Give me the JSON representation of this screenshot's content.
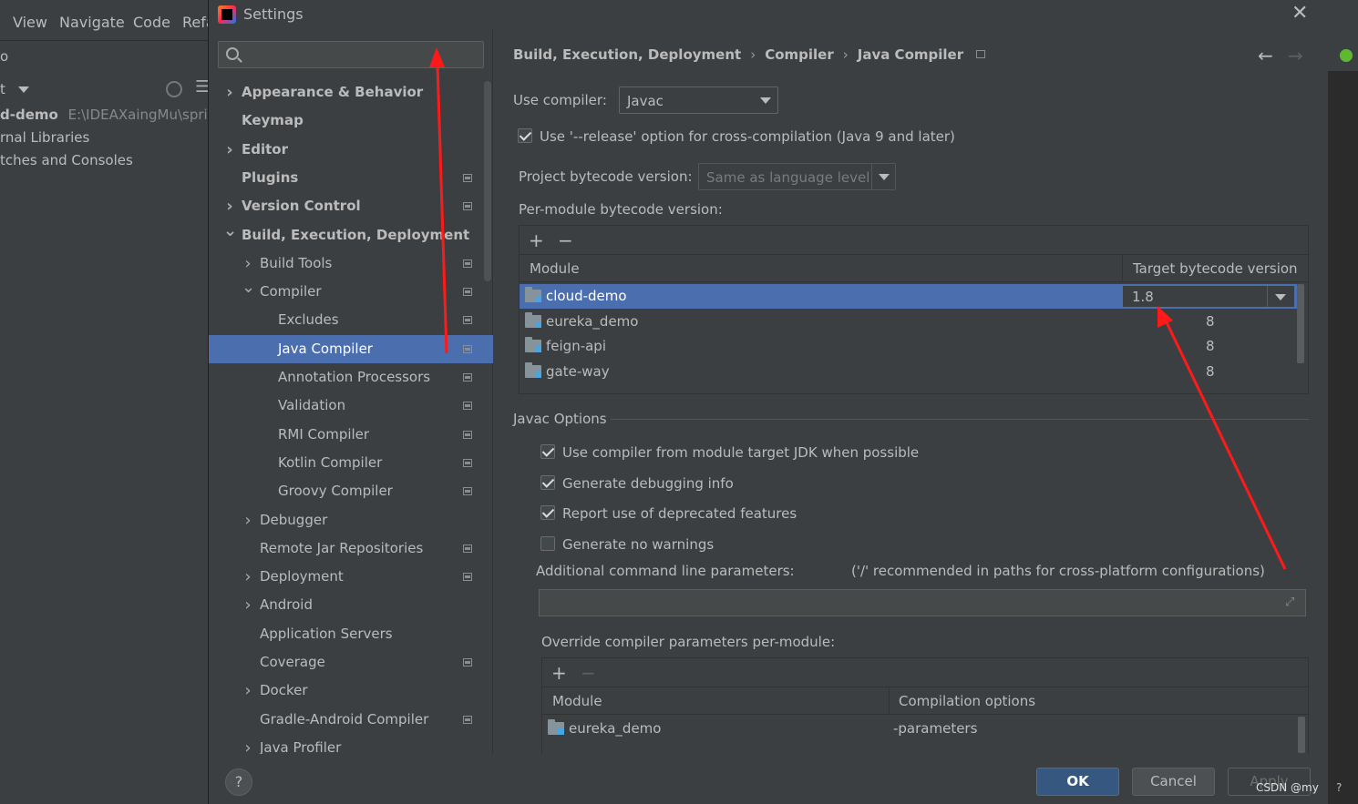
{
  "ide": {
    "menu": [
      "View",
      "Navigate",
      "Code",
      "Refa"
    ],
    "project_lines": [
      {
        "prefix": "d-demo",
        "path": "E:\\IDEAXaingMu\\sprin"
      },
      {
        "prefix": "rnal Libraries",
        "path": ""
      },
      {
        "prefix": "tches and Consoles",
        "path": ""
      }
    ],
    "toolbar_left_partial": "o",
    "toolbar_second_partial": "t"
  },
  "dialog": {
    "title": "Settings",
    "search": {
      "value": "",
      "placeholder": ""
    },
    "tree": [
      {
        "label": "Appearance & Behavior",
        "level": 0,
        "bold": true,
        "chevron": "right",
        "badge": false
      },
      {
        "label": "Keymap",
        "level": 0,
        "bold": true,
        "chevron": "",
        "badge": false
      },
      {
        "label": "Editor",
        "level": 0,
        "bold": true,
        "chevron": "right",
        "badge": false
      },
      {
        "label": "Plugins",
        "level": 0,
        "bold": true,
        "chevron": "",
        "badge": true
      },
      {
        "label": "Version Control",
        "level": 0,
        "bold": true,
        "chevron": "right",
        "badge": true
      },
      {
        "label": "Build, Execution, Deployment",
        "level": 0,
        "bold": true,
        "chevron": "down",
        "badge": false
      },
      {
        "label": "Build Tools",
        "level": 1,
        "bold": false,
        "chevron": "right",
        "badge": true
      },
      {
        "label": "Compiler",
        "level": 1,
        "bold": false,
        "chevron": "down",
        "badge": true
      },
      {
        "label": "Excludes",
        "level": 2,
        "bold": false,
        "chevron": "",
        "badge": true
      },
      {
        "label": "Java Compiler",
        "level": 2,
        "bold": false,
        "chevron": "",
        "badge": true,
        "selected": true
      },
      {
        "label": "Annotation Processors",
        "level": 2,
        "bold": false,
        "chevron": "",
        "badge": true
      },
      {
        "label": "Validation",
        "level": 2,
        "bold": false,
        "chevron": "",
        "badge": true
      },
      {
        "label": "RMI Compiler",
        "level": 2,
        "bold": false,
        "chevron": "",
        "badge": true
      },
      {
        "label": "Kotlin Compiler",
        "level": 2,
        "bold": false,
        "chevron": "",
        "badge": true
      },
      {
        "label": "Groovy Compiler",
        "level": 2,
        "bold": false,
        "chevron": "",
        "badge": true
      },
      {
        "label": "Debugger",
        "level": 1,
        "bold": false,
        "chevron": "right",
        "badge": false
      },
      {
        "label": "Remote Jar Repositories",
        "level": 1,
        "bold": false,
        "chevron": "",
        "badge": true
      },
      {
        "label": "Deployment",
        "level": 1,
        "bold": false,
        "chevron": "right",
        "badge": true
      },
      {
        "label": "Android",
        "level": 1,
        "bold": false,
        "chevron": "right",
        "badge": false
      },
      {
        "label": "Application Servers",
        "level": 1,
        "bold": false,
        "chevron": "",
        "badge": false
      },
      {
        "label": "Coverage",
        "level": 1,
        "bold": false,
        "chevron": "",
        "badge": true
      },
      {
        "label": "Docker",
        "level": 1,
        "bold": false,
        "chevron": "right",
        "badge": false
      },
      {
        "label": "Gradle-Android Compiler",
        "level": 1,
        "bold": false,
        "chevron": "",
        "badge": true
      },
      {
        "label": "Java Profiler",
        "level": 1,
        "bold": false,
        "chevron": "right",
        "badge": false
      }
    ],
    "breadcrumb": [
      "Build, Execution, Deployment",
      "Compiler",
      "Java Compiler"
    ],
    "use_compiler": {
      "label": "Use compiler:",
      "value": "Javac"
    },
    "release_option": {
      "label": "Use '--release' option for cross-compilation (Java 9 and later)",
      "checked": true
    },
    "project_bytecode": {
      "label": "Project bytecode version:",
      "value": "Same as language level"
    },
    "per_module": {
      "label": "Per-module bytecode version:",
      "add": "+",
      "remove": "−",
      "columns": [
        "Module",
        "Target bytecode version"
      ],
      "rows": [
        {
          "module": "cloud-demo",
          "version": "1.8",
          "selected": true
        },
        {
          "module": "eureka_demo",
          "version": "8"
        },
        {
          "module": "feign-api",
          "version": "8"
        },
        {
          "module": "gate-way",
          "version": "8"
        }
      ]
    },
    "javac": {
      "section": "Javac Options",
      "options": [
        {
          "label": "Use compiler from module target JDK when possible",
          "checked": true
        },
        {
          "label": "Generate debugging info",
          "checked": true
        },
        {
          "label": "Report use of deprecated features",
          "checked": true
        },
        {
          "label": "Generate no warnings",
          "checked": false
        }
      ],
      "additional_label": "Additional command line parameters:",
      "additional_hint": "('/' recommended in paths for cross-platform configurations)",
      "additional_value": "",
      "override_label": "Override compiler parameters per-module:",
      "override": {
        "add": "+",
        "remove": "−",
        "columns": [
          "Module",
          "Compilation options"
        ],
        "rows": [
          {
            "module": "eureka_demo",
            "options": "-parameters"
          }
        ]
      }
    },
    "footer": {
      "help": "?",
      "ok": "OK",
      "cancel": "Cancel",
      "apply": "Apply"
    }
  },
  "watermark": "CSDN @my",
  "ide_help": "?",
  "colors": {
    "accent": "#4b6eaf",
    "annotation": "#ff1a1a",
    "ok_button": "#365880"
  }
}
